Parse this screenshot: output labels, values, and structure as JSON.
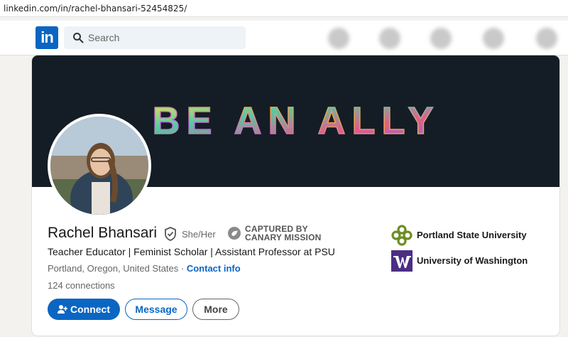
{
  "browser": {
    "url": "linkedin.com/in/rachel-bhansari-52454825/"
  },
  "nav": {
    "logo_text": "in",
    "search_placeholder": "Search"
  },
  "banner": {
    "text": "BE AN ALLY"
  },
  "profile": {
    "name": "Rachel Bhansari",
    "pronouns": "She/Her",
    "headline": "Teacher Educator | Feminist Scholar | Assistant Professor at PSU",
    "location": "Portland, Oregon, United States",
    "separator": " · ",
    "contact_info": "Contact info",
    "connections": "124 connections"
  },
  "stamp": {
    "line1": "CAPTURED BY",
    "line2": "CANARY MISSION"
  },
  "actions": {
    "connect": "Connect",
    "message": "Message",
    "more": "More"
  },
  "education": [
    {
      "name": "Portland State University",
      "logo": "psu-logo",
      "color": "#6d8d24"
    },
    {
      "name": "University of Washington",
      "logo": "uw-logo",
      "color": "#4b2e83"
    }
  ],
  "colors": {
    "brand": "#0a66c2",
    "banner_bg": "#141d25"
  }
}
